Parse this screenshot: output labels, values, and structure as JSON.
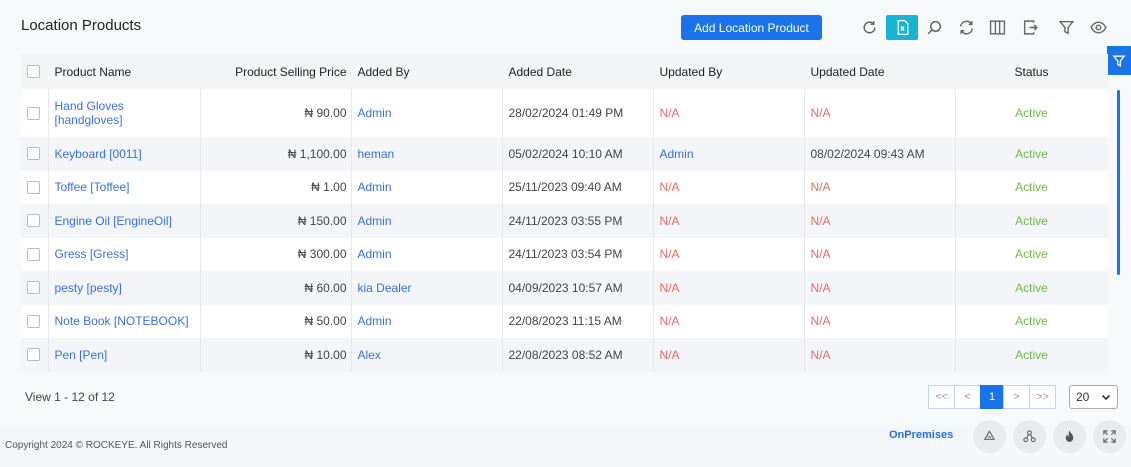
{
  "page": {
    "title": "Location Products",
    "add_button": "Add Location Product"
  },
  "toolbar": {
    "icons": [
      "refresh-icon",
      "export-excel-icon",
      "search-icon",
      "sync-icon",
      "columns-icon",
      "export-icon",
      "filter-icon",
      "view-icon"
    ]
  },
  "table": {
    "columns": [
      "Product Name",
      "Product Selling Price",
      "Added By",
      "Added Date",
      "Updated By",
      "Updated Date",
      "Status"
    ],
    "rows": [
      {
        "name": "Hand Gloves [handgloves]",
        "price": "₦ 90.00",
        "added_by": "Admin",
        "added_date": "28/02/2024 01:49 PM",
        "updated_by": "N/A",
        "updated_date": "N/A",
        "status": "Active"
      },
      {
        "name": "Keyboard [0011]",
        "price": "₦ 1,100.00",
        "added_by": "heman",
        "added_date": "05/02/2024 10:10 AM",
        "updated_by": "Admin",
        "updated_date": "08/02/2024 09:43 AM",
        "status": "Active"
      },
      {
        "name": "Toffee [Toffee]",
        "price": "₦ 1.00",
        "added_by": "Admin",
        "added_date": "25/11/2023 09:40 AM",
        "updated_by": "N/A",
        "updated_date": "N/A",
        "status": "Active"
      },
      {
        "name": "Engine Oil [EngineOil]",
        "price": "₦ 150.00",
        "added_by": "Admin",
        "added_date": "24/11/2023 03:55 PM",
        "updated_by": "N/A",
        "updated_date": "N/A",
        "status": "Active"
      },
      {
        "name": "Gress [Gress]",
        "price": "₦ 300.00",
        "added_by": "Admin",
        "added_date": "24/11/2023 03:54 PM",
        "updated_by": "N/A",
        "updated_date": "N/A",
        "status": "Active"
      },
      {
        "name": "pesty [pesty]",
        "price": "₦ 60.00",
        "added_by": "kia Dealer",
        "added_date": "04/09/2023 10:57 AM",
        "updated_by": "N/A",
        "updated_date": "N/A",
        "status": "Active"
      },
      {
        "name": "Note Book [NOTEBOOK]",
        "price": "₦ 50.00",
        "added_by": "Admin",
        "added_date": "22/08/2023 11:15 AM",
        "updated_by": "N/A",
        "updated_date": "N/A",
        "status": "Active"
      },
      {
        "name": "Pen [Pen]",
        "price": "₦ 10.00",
        "added_by": "Alex",
        "added_date": "22/08/2023 08:52 AM",
        "updated_by": "N/A",
        "updated_date": "N/A",
        "status": "Active"
      }
    ]
  },
  "pagination": {
    "view_info": "View 1 - 12 of 12",
    "first": "<<",
    "prev": "<",
    "current": "1",
    "next": ">",
    "last": ">>",
    "page_size": "20"
  },
  "footer": {
    "copyright": "Copyright 2024 © ROCKEYE. All Rights Reserved",
    "mode": "OnPremises"
  },
  "colors": {
    "accent": "#1a73e8",
    "active_tool": "#17b4d6",
    "status_active": "#74b84a",
    "na": "#e36b6b",
    "link": "#3d6fd9"
  }
}
